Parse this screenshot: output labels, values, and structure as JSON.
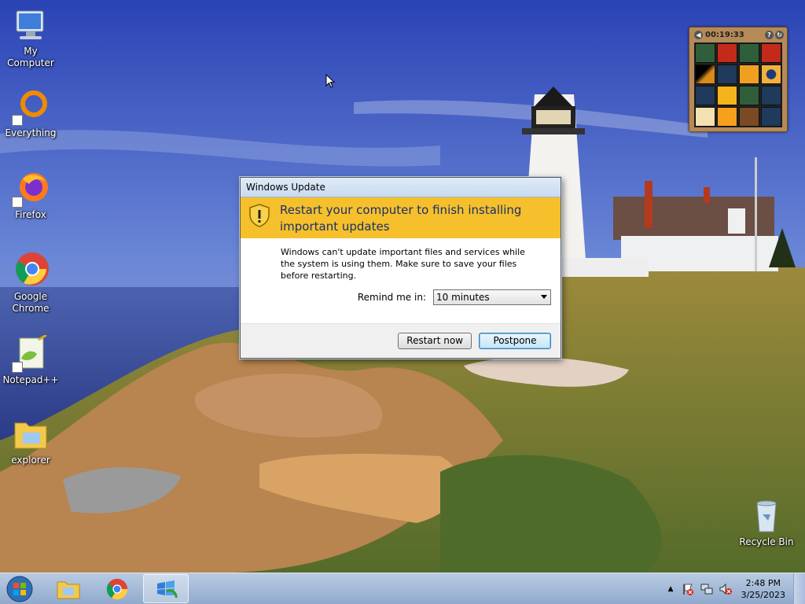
{
  "desktop": {
    "icons": [
      {
        "label": "My Computer",
        "icon": "computer-icon"
      },
      {
        "label": "Everything",
        "icon": "everything-icon"
      },
      {
        "label": "Firefox",
        "icon": "firefox-icon"
      },
      {
        "label": "Google Chrome",
        "icon": "chrome-icon"
      },
      {
        "label": "Notepad++",
        "icon": "notepadpp-icon"
      },
      {
        "label": "explorer",
        "icon": "folder-icon"
      },
      {
        "label": "Recycle Bin",
        "icon": "recycle-bin-icon"
      }
    ]
  },
  "gadget": {
    "timer": "00:19:33",
    "icon": "puzzle-gadget-icon"
  },
  "dialog": {
    "title": "Windows Update",
    "headline_line1": "Restart your computer to finish installing",
    "headline_line2": "important updates",
    "message": "Windows can't update important files and services while the system is using them. Make sure to save your files before restarting.",
    "remind_label": "Remind me in:",
    "remind_value": "10 minutes",
    "restart_label": "Restart now",
    "postpone_label": "Postpone",
    "banner_color": "#f5c02b"
  },
  "taskbar": {
    "pinned": [
      "start-orb-icon",
      "explorer-icon",
      "chrome-icon",
      "windows-update-icon"
    ],
    "clock_time": "2:48 PM",
    "clock_date": "3/25/2023"
  }
}
